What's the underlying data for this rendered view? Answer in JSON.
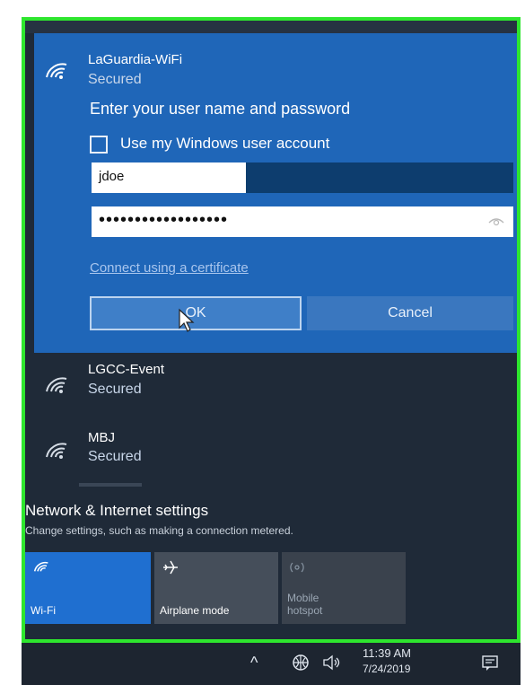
{
  "networks": {
    "active": {
      "ssid": "LaGuardia-WiFi",
      "status": "Secured",
      "prompt": "Enter your user name and password",
      "use_windows_account_label": "Use my Windows user account",
      "username_value": "jdoe",
      "password_value": "••••••••••••••••••",
      "cert_link": "Connect using a certificate",
      "ok_label": "OK",
      "cancel_label": "Cancel"
    },
    "list": [
      {
        "ssid": "LGCC-Event",
        "status": "Secured"
      },
      {
        "ssid": "MBJ",
        "status": "Secured"
      }
    ]
  },
  "settings": {
    "title": "Network & Internet settings",
    "subtitle": "Change settings, such as making a connection metered."
  },
  "quick_actions": [
    {
      "label": "Wi-Fi",
      "icon": "wifi-icon",
      "state": "on"
    },
    {
      "label": "Airplane mode",
      "icon": "airplane-icon",
      "state": "off"
    },
    {
      "label": "Mobile hotspot",
      "icon": "hotspot-icon",
      "state": "disabled"
    }
  ],
  "taskbar": {
    "time": "11:39 AM",
    "date": "7/24/2019"
  },
  "colors": {
    "accent": "#1f66b8",
    "panel": "#1f2a38",
    "highlight_border": "#2ee62e"
  }
}
